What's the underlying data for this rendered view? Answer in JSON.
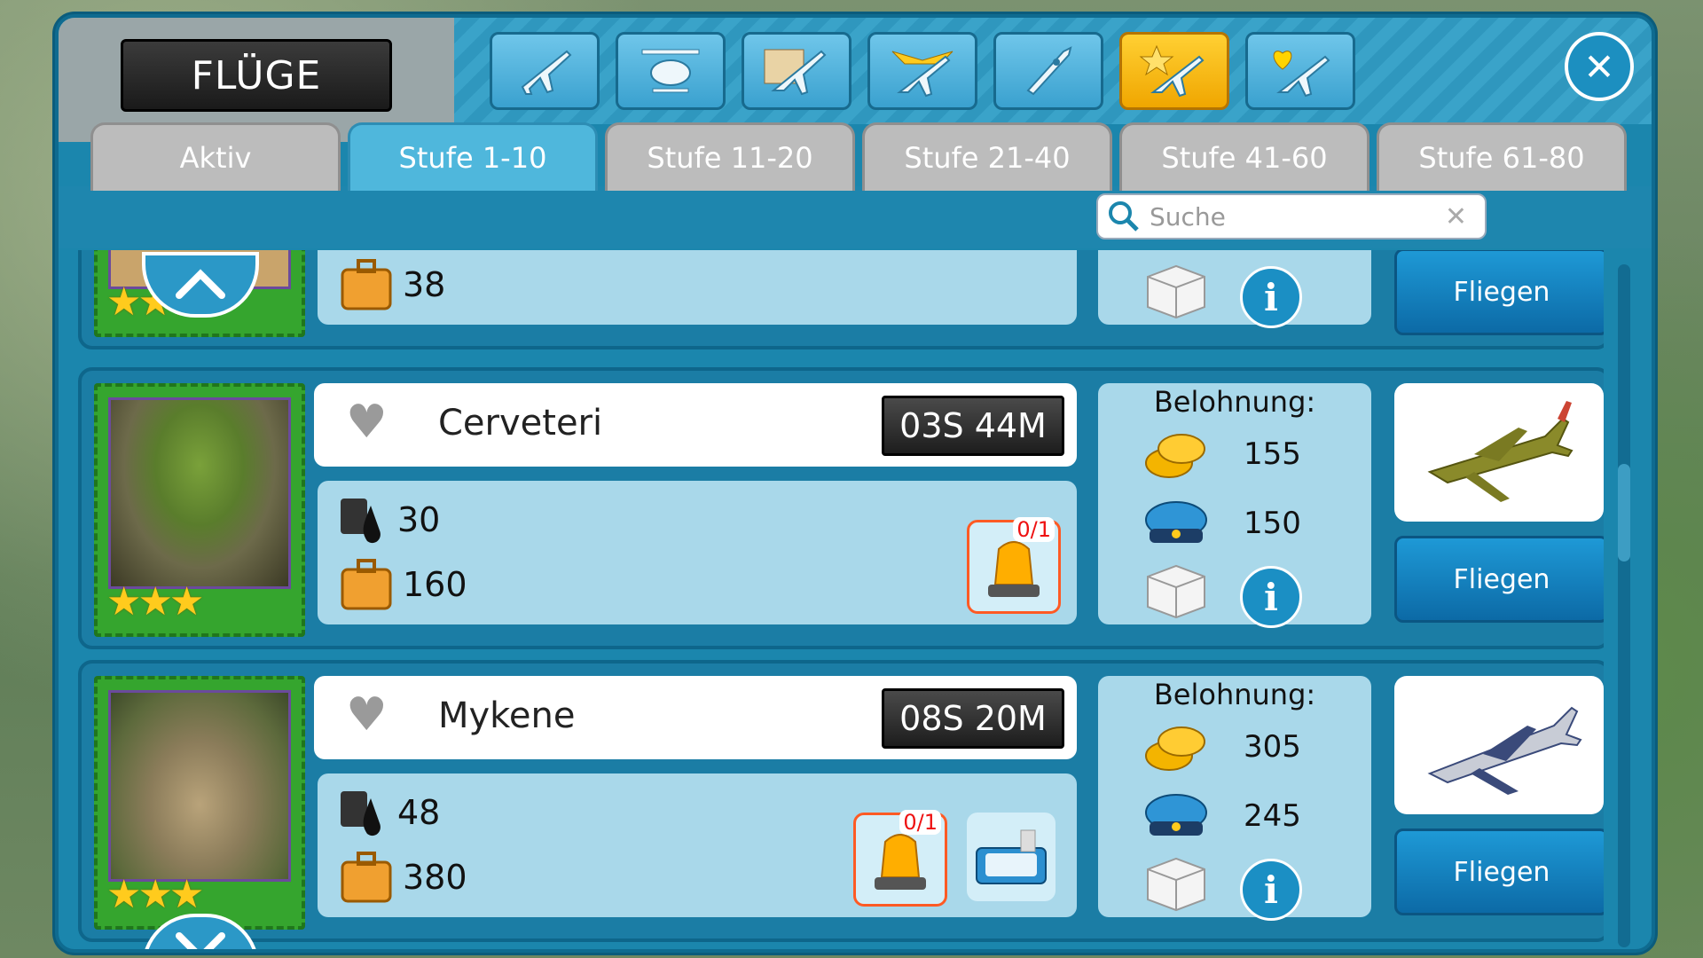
{
  "window": {
    "title": "FLÜGE",
    "close": "✕"
  },
  "categories": [
    {
      "icon": "jet-plane-icon",
      "active": false
    },
    {
      "icon": "helicopter-icon",
      "active": false
    },
    {
      "icon": "map-plane-icon",
      "active": false
    },
    {
      "icon": "winged-plane-icon",
      "active": false
    },
    {
      "icon": "rocket-icon",
      "active": false
    },
    {
      "icon": "star-plane-icon",
      "active": true
    },
    {
      "icon": "heart-plane-icon",
      "active": false
    }
  ],
  "tabs": [
    "Aktiv",
    "Stufe 1-10",
    "Stufe 11-20",
    "Stufe 21-40",
    "Stufe 41-60",
    "Stufe 61-80"
  ],
  "search": {
    "placeholder": "Suche",
    "clear": "✕"
  },
  "flights": [
    {
      "name": "",
      "timer": "",
      "bags": "38",
      "fly": "Fliegen"
    },
    {
      "name": "Cerveteri",
      "timer": "03S 44M",
      "fuel": "30",
      "bags": "160",
      "reward_label": "Belohnung:",
      "coins": "155",
      "pilots": "150",
      "extra_badge": "0/1",
      "fly": "Fliegen"
    },
    {
      "name": "Mykene",
      "timer": "08S 20M",
      "fuel": "48",
      "bags": "380",
      "reward_label": "Belohnung:",
      "coins": "305",
      "pilots": "245",
      "extra_badge": "0/1",
      "fly": "Fliegen"
    }
  ],
  "colors": {
    "accent": "#1b86ad",
    "active_tab": "#4fb7dc",
    "gold": "#ffcb1d",
    "fly_button": "#1e99d6"
  }
}
